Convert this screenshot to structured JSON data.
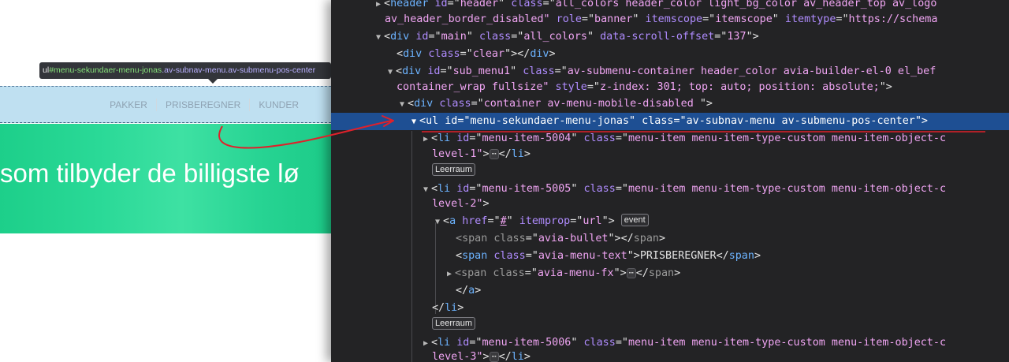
{
  "preview": {
    "tooltip": {
      "tag": "ul",
      "selector_id": "#menu-sekundaer-menu-jonas",
      "selector_classes": ".av-subnav-menu.av-submenu-pos-center"
    },
    "submenu_items": [
      {
        "label": "PAKKER"
      },
      {
        "label": "PRISBEREGNER"
      },
      {
        "label": "KUNDER"
      }
    ],
    "hero_text": "som tilbyder de billigste lø",
    "colors": {
      "submenu_bg": "#bfe0f1",
      "hero_green": "#2ad997",
      "annotation_red": "#e0202a"
    }
  },
  "dom": {
    "l1a": {
      "tag": "header",
      "id_attr": "id",
      "id_val": "header",
      "cls_attr": "class",
      "cls_val": "all_colors header_color light_bg_color av_header_top av_logo"
    },
    "l1b": {
      "text": "av_header_border_disabled\"",
      "role_attr": "role",
      "role_val": "banner",
      "scope_attr": "itemscope",
      "scope_val": "itemscope",
      "type_attr": "itemtype",
      "type_val": "https://schema"
    },
    "l2": {
      "tag": "div",
      "id_attr": "id",
      "id_val": "main",
      "cls_attr": "class",
      "cls_val": "all_colors",
      "off_attr": "data-scroll-offset",
      "off_val": "137"
    },
    "l3": {
      "tag": "div",
      "cls_attr": "class",
      "cls_val": "clear",
      "close": "div"
    },
    "l4a": {
      "tag": "div",
      "id_attr": "id",
      "id_val": "sub_menu1",
      "cls_attr": "class",
      "cls_val": "av-submenu-container header_color avia-builder-el-0 el_bef"
    },
    "l4b": {
      "text": "container_wrap fullsize\"",
      "style_attr": "style",
      "style_val": "z-index: 301; top: auto; position: absolute;"
    },
    "l5": {
      "tag": "div",
      "cls_attr": "class",
      "cls_val": "container av-menu-mobile-disabled "
    },
    "l6": {
      "tag": "ul",
      "id_attr": "id",
      "id_val": "menu-sekundaer-menu-jonas",
      "cls_attr": "class",
      "cls_val": "av-subnav-menu av-submenu-pos-center"
    },
    "l7a": {
      "tag": "li",
      "id_attr": "id",
      "id_val": "menu-item-5004",
      "cls_attr": "class",
      "cls_val": "menu-item menu-item-type-custom menu-item-object-c"
    },
    "l7b": {
      "text": "level-1\"",
      "close": "li"
    },
    "badge1": "Leerraum",
    "l8a": {
      "tag": "li",
      "id_attr": "id",
      "id_val": "menu-item-5005",
      "cls_attr": "class",
      "cls_val": "menu-item menu-item-type-custom menu-item-object-c"
    },
    "l8b": {
      "text": "level-2\""
    },
    "l9": {
      "tag": "a",
      "href_attr": "href",
      "href_val": "#",
      "prop_attr": "itemprop",
      "prop_val": "url",
      "event_badge": "event"
    },
    "l10": {
      "tag": "span",
      "cls_attr": "class",
      "cls_val": "avia-bullet",
      "close": "span"
    },
    "l11": {
      "tag": "span",
      "cls_attr": "class",
      "cls_val": "avia-menu-text",
      "content": "PRISBEREGNER",
      "close": "span"
    },
    "l12": {
      "tag": "span",
      "cls_attr": "class",
      "cls_val": "avia-menu-fx",
      "close": "span"
    },
    "l13": {
      "close": "a"
    },
    "l14": {
      "close": "li"
    },
    "badge2": "Leerraum",
    "l15a": {
      "tag": "li",
      "id_attr": "id",
      "id_val": "menu-item-5006",
      "cls_attr": "class",
      "cls_val": "menu-item menu-item-type-custom menu-item-object-c"
    },
    "l15b": {
      "text": "level-3\"",
      "close": "li"
    }
  }
}
